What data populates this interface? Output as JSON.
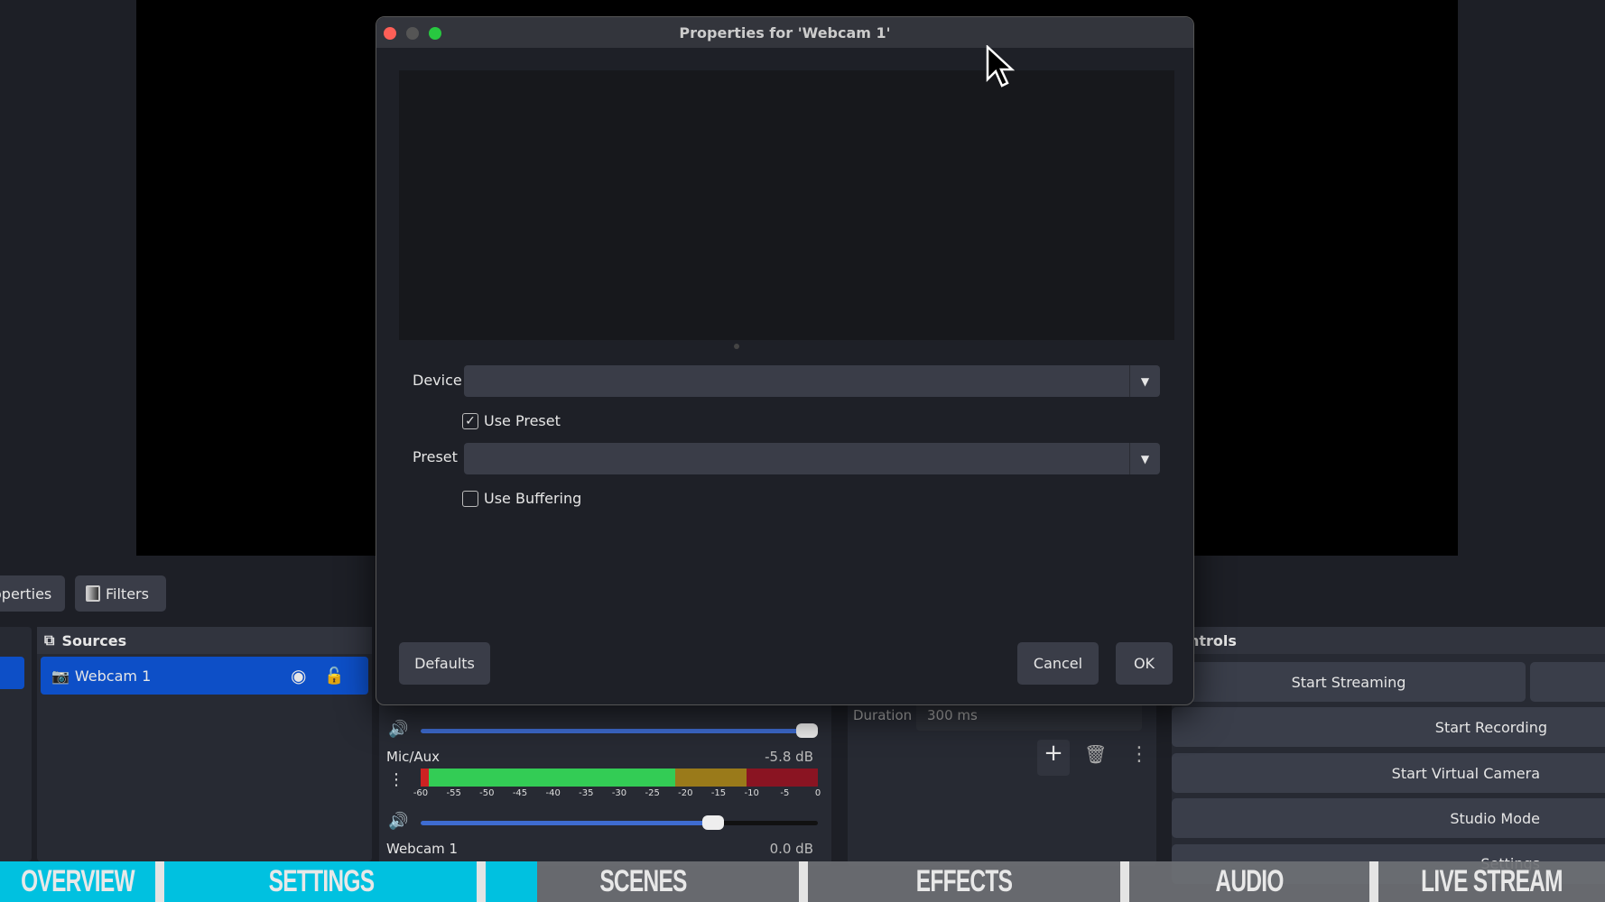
{
  "dialog": {
    "title": "Properties for 'Webcam 1'",
    "device_label": "Device",
    "device_value": "",
    "use_preset_label": "Use Preset",
    "use_preset_checked": true,
    "preset_label": "Preset",
    "preset_value": "",
    "use_buffering_label": "Use Buffering",
    "use_buffering_checked": false,
    "defaults": "Defaults",
    "cancel": "Cancel",
    "ok": "OK"
  },
  "toolbar": {
    "properties": "operties",
    "filters": "Filters"
  },
  "sources": {
    "title": "Sources",
    "items": [
      {
        "label": "Webcam 1",
        "visible": true,
        "locked": false
      }
    ]
  },
  "mixer": {
    "tracks": [
      {
        "name": "",
        "volume": 1.0
      },
      {
        "name": "Mic/Aux",
        "db": "-5.8 dB",
        "volume": 0.73,
        "level_db": -21,
        "peak_db": -9.5
      },
      {
        "name": "Webcam 1",
        "db": "0.0 dB"
      }
    ],
    "scale": [
      "-60",
      "-55",
      "-50",
      "-45",
      "-40",
      "-35",
      "-30",
      "-25",
      "-20",
      "-15",
      "-10",
      "-5",
      "0"
    ]
  },
  "transitions": {
    "duration_label": "Duration",
    "duration_value": "300 ms"
  },
  "controls": {
    "title": "ontrols",
    "buttons": [
      "Start Streaming",
      "Start Recording",
      "Start Virtual Camera",
      "Studio Mode",
      "Settings"
    ]
  },
  "nav": {
    "items": [
      "OVERVIEW",
      "SETTINGS",
      "SCENES",
      "EFFECTS",
      "AUDIO",
      "LIVE STREAM"
    ],
    "active_color": "#00c1e0"
  },
  "colors": {
    "accent": "#0d4fc7",
    "meter_green": "#33cc55",
    "meter_yellow": "#9a7a1a",
    "meter_red": "#8a1422"
  }
}
